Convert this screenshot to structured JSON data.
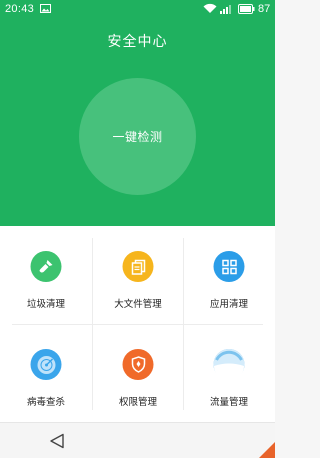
{
  "status_bar": {
    "time": "20:43",
    "battery": "87"
  },
  "header": {
    "title": "安全中心"
  },
  "scan": {
    "label": "一键检测"
  },
  "grid": {
    "items": [
      {
        "label": "垃圾清理",
        "icon": "broom-icon",
        "color": "#3cc36f"
      },
      {
        "label": "大文件管理",
        "icon": "files-icon",
        "color": "#f6b51d"
      },
      {
        "label": "应用清理",
        "icon": "apps-grid-icon",
        "color": "#2b9de8"
      },
      {
        "label": "病毒查杀",
        "icon": "radar-icon",
        "color": "#3aa5eb"
      },
      {
        "label": "权限管理",
        "icon": "shield-icon",
        "color": "#f06a2a"
      },
      {
        "label": "流量管理",
        "icon": "traffic-gauge-icon",
        "color": "#7cc3ee"
      }
    ]
  },
  "colors": {
    "header_bg": "#1fb15f",
    "scan_circle": "#47c17c"
  }
}
